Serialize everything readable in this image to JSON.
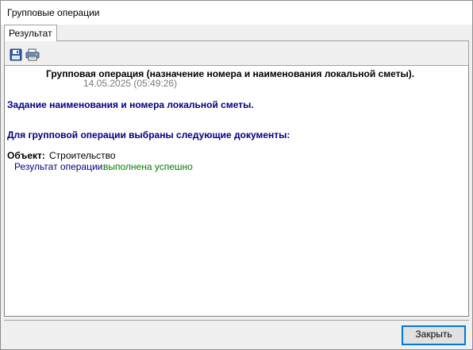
{
  "window": {
    "title": "Групповые операции"
  },
  "tabs": [
    {
      "label": "Результат"
    }
  ],
  "toolbar": {
    "save_icon": "save-icon",
    "print_icon": "print-icon"
  },
  "report": {
    "title": "Групповая операция (назначение номера и наименования локальной сметы).",
    "datetime": "14.05.2025 (05:49:26)",
    "task": "Задание наименования и номера локальной сметы.",
    "selected_docs": "Для групповой операции выбраны следующие документы:",
    "object_label": "Объект:",
    "object_value": "Строительство",
    "result_label": "Результат операции:",
    "result_value": "выполнена успешно"
  },
  "footer": {
    "close_label": "Закрыть"
  },
  "colors": {
    "heading_blue": "#000080",
    "success_green": "#008000",
    "date_gray": "#7a7a7a",
    "accent_border": "#0078d7"
  }
}
